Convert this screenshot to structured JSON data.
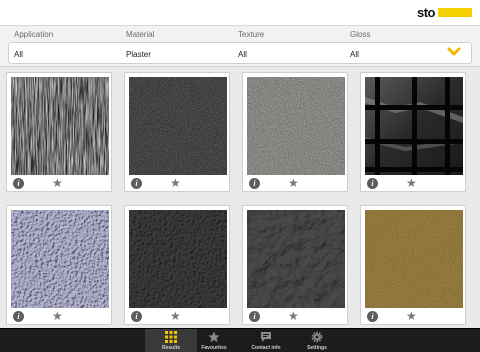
{
  "brand": {
    "logo_text": "sto",
    "accent": "#f4d000"
  },
  "filters": [
    {
      "label": "Application",
      "value": "All"
    },
    {
      "label": "Material",
      "value": "Plaster"
    },
    {
      "label": "Texture",
      "value": "All"
    },
    {
      "label": "Gloss",
      "value": "All"
    }
  ],
  "cards": [
    {
      "swatch": "vertical-streak-dark",
      "info_icon": "i",
      "fav_icon": "★"
    },
    {
      "swatch": "fine-grain-dark",
      "info_icon": "i",
      "fav_icon": "★"
    },
    {
      "swatch": "fine-grain-grey",
      "info_icon": "i",
      "fav_icon": "★"
    },
    {
      "swatch": "black-tile-grid",
      "info_icon": "i",
      "fav_icon": "★"
    },
    {
      "swatch": "light-lavender-stucco",
      "info_icon": "i",
      "fav_icon": "★"
    },
    {
      "swatch": "rough-charcoal",
      "info_icon": "i",
      "fav_icon": "★"
    },
    {
      "swatch": "swirled-charcoal",
      "info_icon": "i",
      "fav_icon": "★"
    },
    {
      "swatch": "gold-brown-grain",
      "info_icon": "i",
      "fav_icon": "★"
    }
  ],
  "tabbar": [
    {
      "label": "Results",
      "icon": "grid-icon",
      "active": true
    },
    {
      "label": "Favourites",
      "icon": "star-icon",
      "active": false
    },
    {
      "label": "Contact info",
      "icon": "speech-bubble-icon",
      "active": false
    },
    {
      "label": "Settings",
      "icon": "gear-icon",
      "active": false
    }
  ]
}
